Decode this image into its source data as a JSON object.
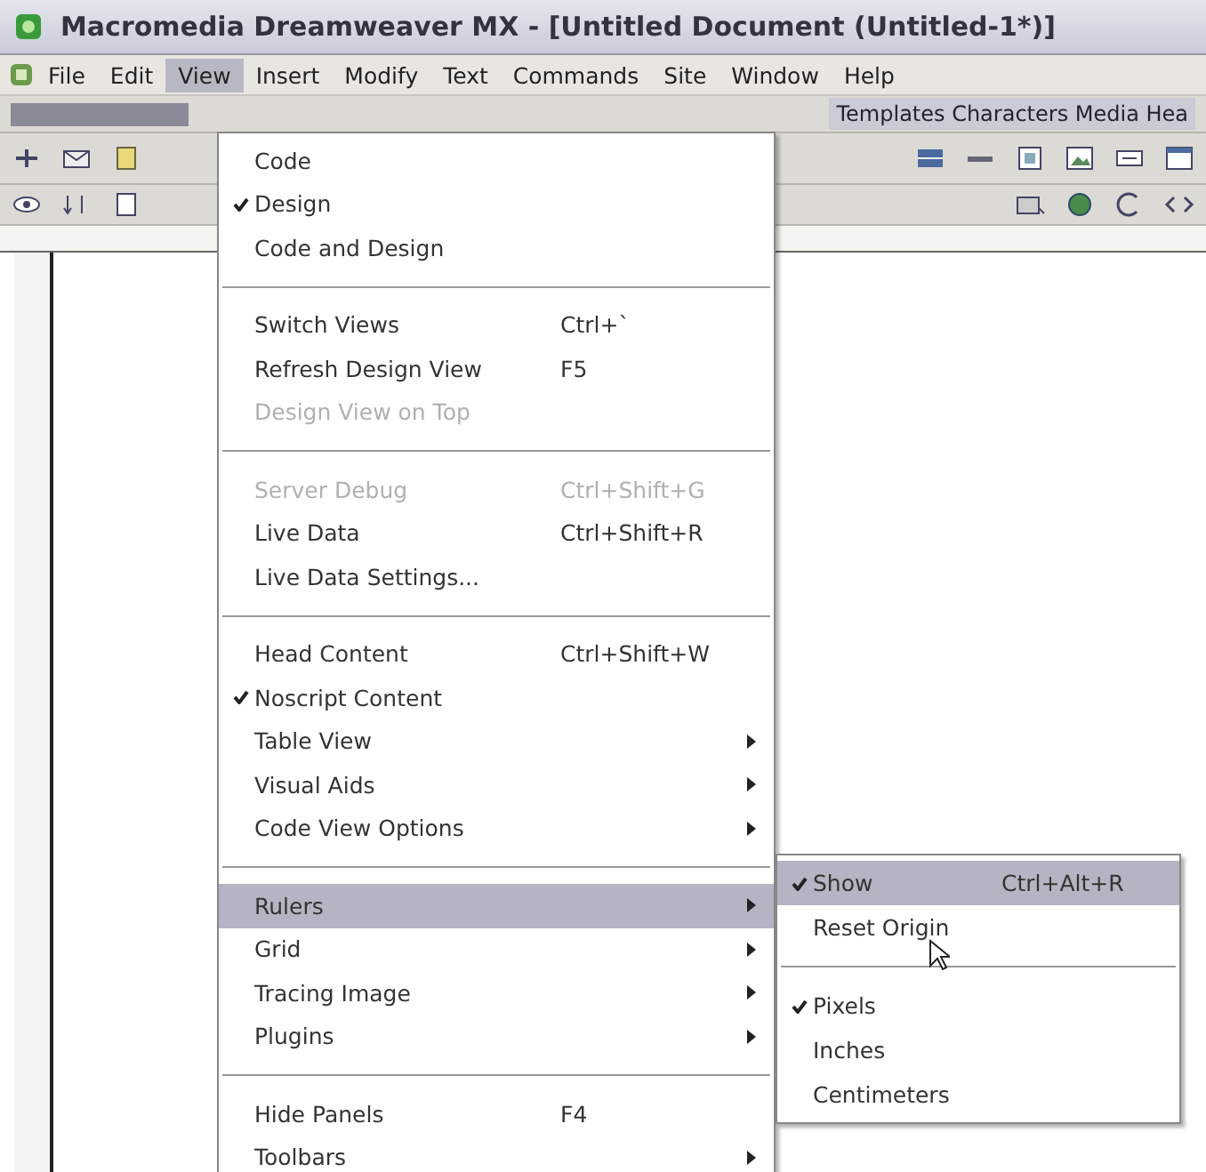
{
  "window": {
    "title": "Macromedia Dreamweaver MX - [Untitled Document (Untitled-1*)]"
  },
  "menubar": [
    {
      "label": "File",
      "selected": false
    },
    {
      "label": "Edit",
      "selected": false
    },
    {
      "label": "View",
      "selected": true
    },
    {
      "label": "Insert",
      "selected": false
    },
    {
      "label": "Modify",
      "selected": false
    },
    {
      "label": "Text",
      "selected": false
    },
    {
      "label": "Commands",
      "selected": false
    },
    {
      "label": "Site",
      "selected": false
    },
    {
      "label": "Window",
      "selected": false
    },
    {
      "label": "Help",
      "selected": false
    }
  ],
  "insert_bar": {
    "tabs": "Templates  Characters  Media  Hea"
  },
  "view_menu": [
    {
      "kind": "item",
      "label": "Code",
      "checked": false,
      "disabled": false,
      "selected": false
    },
    {
      "kind": "item",
      "label": "Design",
      "checked": true,
      "disabled": false,
      "selected": false
    },
    {
      "kind": "item",
      "label": "Code and Design",
      "checked": false,
      "disabled": false,
      "selected": false
    },
    {
      "kind": "separator"
    },
    {
      "kind": "item",
      "label": "Switch Views",
      "shortcut": "Ctrl+`",
      "checked": false,
      "disabled": false,
      "selected": false
    },
    {
      "kind": "item",
      "label": "Refresh Design View",
      "shortcut": "F5",
      "checked": false,
      "disabled": false,
      "selected": false
    },
    {
      "kind": "item",
      "label": "Design View on Top",
      "checked": false,
      "disabled": true,
      "selected": false
    },
    {
      "kind": "separator"
    },
    {
      "kind": "item",
      "label": "Server Debug",
      "shortcut": "Ctrl+Shift+G",
      "checked": false,
      "disabled": true,
      "selected": false
    },
    {
      "kind": "item",
      "label": "Live Data",
      "shortcut": "Ctrl+Shift+R",
      "checked": false,
      "disabled": false,
      "selected": false
    },
    {
      "kind": "item",
      "label": "Live Data Settings...",
      "checked": false,
      "disabled": false,
      "selected": false
    },
    {
      "kind": "separator"
    },
    {
      "kind": "item",
      "label": "Head Content",
      "shortcut": "Ctrl+Shift+W",
      "checked": false,
      "disabled": false,
      "selected": false
    },
    {
      "kind": "item",
      "label": "Noscript Content",
      "checked": true,
      "disabled": false,
      "selected": false
    },
    {
      "kind": "submenu",
      "label": "Table View",
      "checked": false,
      "disabled": false,
      "selected": false
    },
    {
      "kind": "submenu",
      "label": "Visual Aids",
      "checked": false,
      "disabled": false,
      "selected": false
    },
    {
      "kind": "submenu",
      "label": "Code View Options",
      "checked": false,
      "disabled": false,
      "selected": false
    },
    {
      "kind": "separator"
    },
    {
      "kind": "submenu",
      "label": "Rulers",
      "checked": false,
      "disabled": false,
      "selected": true
    },
    {
      "kind": "submenu",
      "label": "Grid",
      "checked": false,
      "disabled": false,
      "selected": false
    },
    {
      "kind": "submenu",
      "label": "Tracing Image",
      "checked": false,
      "disabled": false,
      "selected": false
    },
    {
      "kind": "submenu",
      "label": "Plugins",
      "checked": false,
      "disabled": false,
      "selected": false
    },
    {
      "kind": "separator"
    },
    {
      "kind": "item",
      "label": "Hide Panels",
      "shortcut": "F4",
      "checked": false,
      "disabled": false,
      "selected": false
    },
    {
      "kind": "submenu",
      "label": "Toolbars",
      "checked": false,
      "disabled": false,
      "selected": false
    }
  ],
  "rulers_menu": [
    {
      "kind": "item",
      "label": "Show",
      "shortcut": "Ctrl+Alt+R",
      "checked": true,
      "selected": true
    },
    {
      "kind": "item",
      "label": "Reset Origin",
      "checked": false,
      "selected": false
    },
    {
      "kind": "separator"
    },
    {
      "kind": "item",
      "label": "Pixels",
      "checked": true,
      "selected": false
    },
    {
      "kind": "item",
      "label": "Inches",
      "checked": false,
      "selected": false
    },
    {
      "kind": "item",
      "label": "Centimeters",
      "checked": false,
      "selected": false
    }
  ]
}
